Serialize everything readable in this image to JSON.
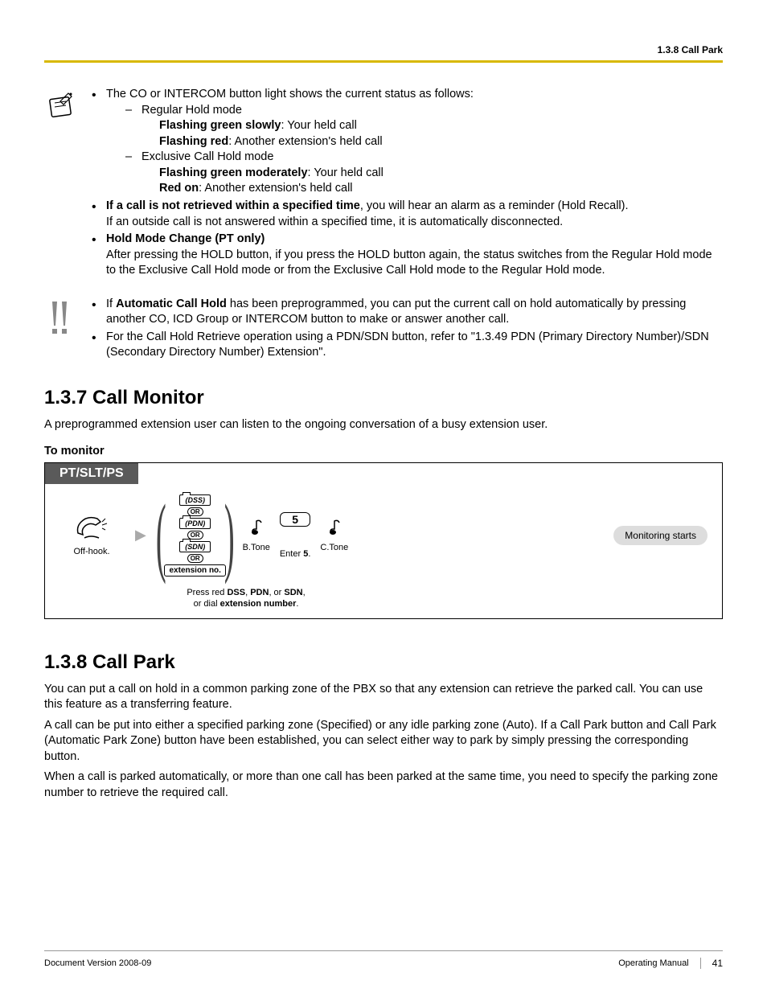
{
  "header": {
    "section_ref": "1.3.8 Call Park"
  },
  "note1": {
    "bullets": [
      {
        "lead": "The CO or INTERCOM button light shows the current status as follows:",
        "subs": [
          {
            "title": "Regular Hold mode",
            "lines": [
              {
                "b": "Flashing green slowly",
                "rest": ": Your held call"
              },
              {
                "b": "Flashing red",
                "rest": ": Another extension's held call"
              }
            ]
          },
          {
            "title": "Exclusive Call Hold mode",
            "lines": [
              {
                "b": "Flashing green moderately",
                "rest": ": Your held call"
              },
              {
                "b": "Red on",
                "rest": ": Another extension's held call"
              }
            ]
          }
        ]
      },
      {
        "bold_lead": "If a call is not retrieved within a specified time",
        "rest": ", you will hear an alarm as a reminder (Hold Recall).",
        "extra": "If an outside call is not answered within a specified time, it is automatically disconnected."
      },
      {
        "bold_lead": "Hold Mode Change (PT only)",
        "rest": "",
        "extra": "After pressing the HOLD button, if you press the HOLD button again, the status switches from the Regular Hold mode to the Exclusive Call Hold mode or from the Exclusive Call Hold mode to the Regular Hold mode."
      }
    ]
  },
  "note2": {
    "bullets": [
      {
        "pre": "If ",
        "bold": "Automatic Call Hold",
        "post": " has been preprogrammed, you can put the current call on hold automatically by pressing another CO, ICD Group or INTERCOM button to make or answer another call."
      },
      {
        "text": "For the Call Hold Retrieve operation using a PDN/SDN button, refer to \"1.3.49  PDN (Primary Directory Number)/SDN (Secondary Directory Number) Extension\"."
      }
    ]
  },
  "sec137": {
    "title": "1.3.7  Call Monitor",
    "intro": "A preprogrammed extension user can listen to the ongoing conversation of a busy extension user.",
    "subhead": "To monitor",
    "tab": "PT/SLT/PS",
    "steps": {
      "offhook": "Off-hook.",
      "btns": {
        "dss": "(DSS)",
        "pdn": "(PDN)",
        "sdn": "(SDN)",
        "or": "OR",
        "ext": "extension no."
      },
      "press_caption_1": "Press red ",
      "press_b1": "DSS",
      "press_m1": ", ",
      "press_b2": "PDN",
      "press_m2": ", or ",
      "press_b3": "SDN",
      "press_m3": ",",
      "press_caption_2": "or dial ",
      "press_b4": "extension number",
      "press_end": ".",
      "btone": "B.Tone",
      "digit": "5",
      "enter5_pre": "Enter ",
      "enter5_b": "5",
      "enter5_post": ".",
      "ctone": "C.Tone",
      "monitoring": "Monitoring starts"
    }
  },
  "sec138": {
    "title": "1.3.8  Call Park",
    "paras": [
      "You can put a call on hold in a common parking zone of the PBX so that any extension can retrieve the parked call. You can use this feature as a transferring feature.",
      "A call can be put into either a specified parking zone (Specified) or any idle parking zone (Auto). If a Call Park button and Call Park (Automatic Park Zone) button have been established, you can select either way to park by simply pressing the corresponding button.",
      "When a call is parked automatically, or more than one call has been parked at the same time, you need to specify the parking zone number to retrieve the required call."
    ]
  },
  "footer": {
    "left": "Document Version  2008-09",
    "right_label": "Operating Manual",
    "page": "41"
  }
}
